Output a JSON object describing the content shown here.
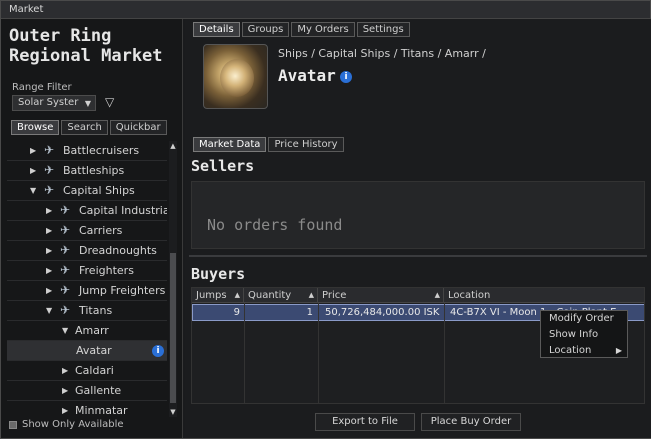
{
  "window": {
    "title": "Market"
  },
  "left_panel": {
    "market_title": "Outer Ring Regional Market",
    "range_filter_label": "Range Filter",
    "range_filter_value": "Solar Syster",
    "tabs": [
      "Browse",
      "Search",
      "Quickbar"
    ],
    "tree": [
      {
        "label": "Battlecruisers",
        "expanded": false
      },
      {
        "label": "Battleships",
        "expanded": false
      },
      {
        "label": "Capital Ships",
        "expanded": true
      },
      {
        "label": "Capital Industria",
        "expanded": false
      },
      {
        "label": "Carriers",
        "expanded": false
      },
      {
        "label": "Dreadnoughts",
        "expanded": false
      },
      {
        "label": "Freighters",
        "expanded": false
      },
      {
        "label": "Jump Freighters",
        "expanded": false
      },
      {
        "label": "Titans",
        "expanded": true
      },
      {
        "label": "Amarr",
        "expanded": true
      },
      {
        "label": "Avatar",
        "selected": true
      },
      {
        "label": "Caldari",
        "expanded": false
      },
      {
        "label": "Gallente",
        "expanded": false
      },
      {
        "label": "Minmatar",
        "expanded": false
      }
    ],
    "show_only_available": "Show Only Available"
  },
  "right_panel": {
    "tabs": [
      "Details",
      "Groups",
      "My Orders",
      "Settings"
    ],
    "breadcrumb": "Ships / Capital Ships / Titans / Amarr /",
    "item_name": "Avatar",
    "data_tabs": [
      "Market Data",
      "Price History"
    ],
    "sellers_title": "Sellers",
    "no_orders": "No orders found",
    "buyers_title": "Buyers",
    "columns": [
      "Jumps",
      "Quantity",
      "Price",
      "Location"
    ],
    "buy_orders": [
      {
        "jumps": "9",
        "quantity": "1",
        "price": "50,726,484,000.00 ISK",
        "location": "4C-B7X VI - Moon 1 - Coin Plant E"
      }
    ],
    "context_menu": [
      "Modify Order",
      "Show Info",
      "Location"
    ],
    "buttons": {
      "export": "Export to File",
      "place_buy": "Place Buy Order"
    }
  }
}
